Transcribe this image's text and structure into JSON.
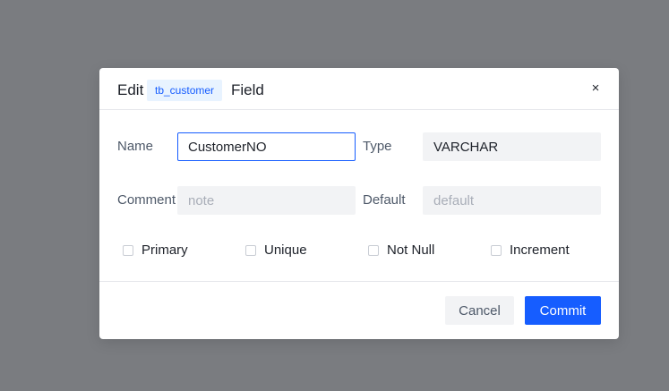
{
  "dialog": {
    "title_prefix": "Edit",
    "table_tag": "tb_customer",
    "title_suffix": "Field",
    "close_symbol": "×"
  },
  "form": {
    "name": {
      "label": "Name",
      "value": "CustomerNO",
      "placeholder": ""
    },
    "type": {
      "label": "Type",
      "value": "VARCHAR",
      "placeholder": ""
    },
    "comment": {
      "label": "Comment",
      "value": "",
      "placeholder": "note"
    },
    "default": {
      "label": "Default",
      "value": "",
      "placeholder": "default"
    },
    "checkboxes": [
      {
        "label": "Primary",
        "checked": false
      },
      {
        "label": "Unique",
        "checked": false
      },
      {
        "label": "Not Null",
        "checked": false
      },
      {
        "label": "Increment",
        "checked": false
      }
    ]
  },
  "footer": {
    "cancel_label": "Cancel",
    "commit_label": "Commit"
  },
  "colors": {
    "overlay": "#7a7c80",
    "primary": "#165dff",
    "tag_bg": "#e8f3ff",
    "input_bg": "#f2f3f5"
  }
}
